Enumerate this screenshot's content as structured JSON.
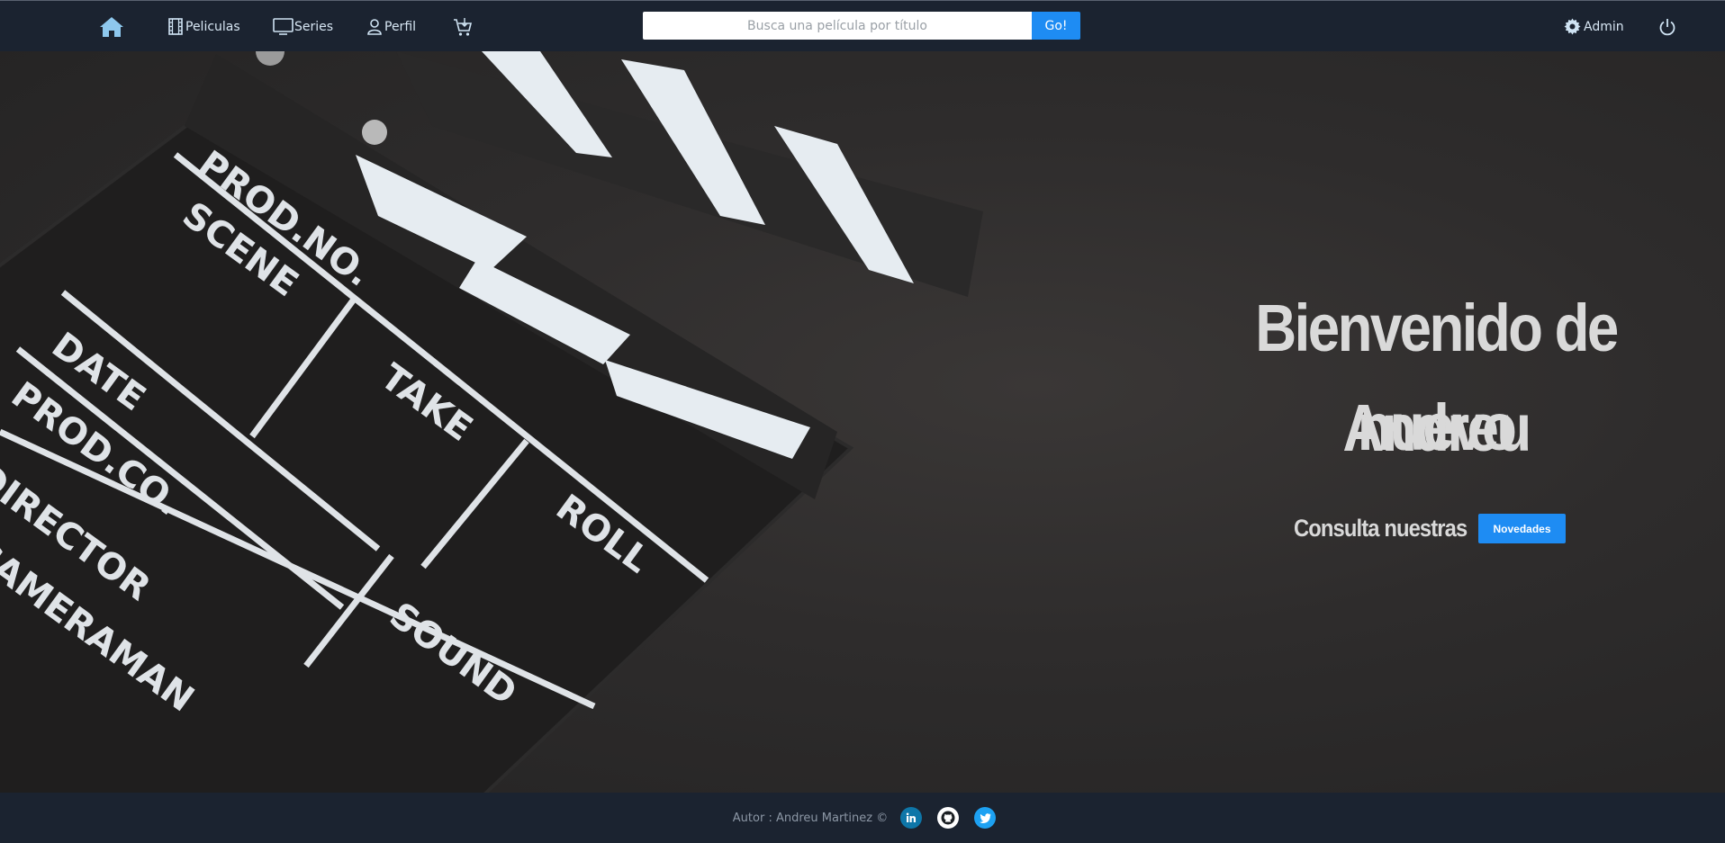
{
  "nav": {
    "peliculas_label": "Peliculas",
    "series_label": "Series",
    "perfil_label": "Perfil",
    "admin_label": "Admin",
    "icons": [
      "home-icon",
      "film-icon",
      "tv-icon",
      "user-icon",
      "cart-icon",
      "gear-icon",
      "power-icon"
    ]
  },
  "search": {
    "placeholder": "Busca una película por título",
    "value": "",
    "button_label": "Go!"
  },
  "hero": {
    "title_line1": "Bienvenido de nuevo",
    "title_line2": "Andreu",
    "cta_text": "Consulta nuestras",
    "cta_button": "Novedades",
    "clapperboard_labels": [
      "PROD.NO.",
      "SCENE",
      "TAKE",
      "ROLL",
      "DATE",
      "PROD.CO.",
      "DIRECTOR",
      "CAMERAMAN",
      "SOUND"
    ]
  },
  "footer": {
    "author": "Autor : Andreu Martinez ©",
    "social": [
      "linkedin-icon",
      "github-icon",
      "twitter-icon"
    ]
  },
  "colors": {
    "navbar_bg": "#1b2330",
    "accent": "#1e8cf3",
    "hero_text": "#d9d9d9",
    "nav_text": "#d7e6f3"
  }
}
